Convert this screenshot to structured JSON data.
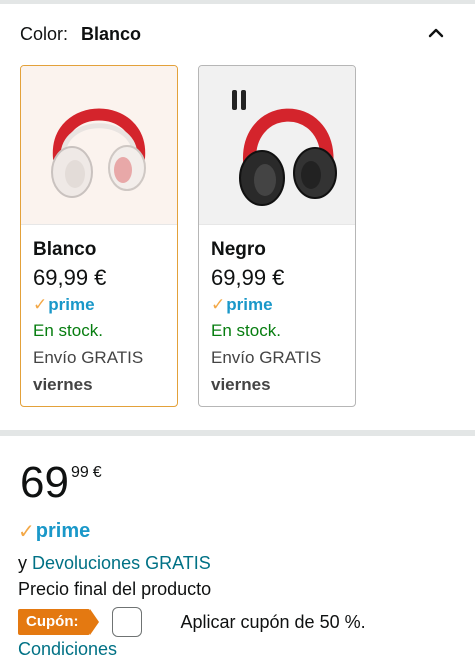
{
  "color_selector": {
    "label": "Color:",
    "selected": "Blanco",
    "swatches": [
      {
        "name": "Blanco",
        "price": "69,99 €",
        "prime": "prime",
        "stock": "En stock.",
        "shipping": "Envío GRATIS",
        "day": "viernes"
      },
      {
        "name": "Negro",
        "price": "69,99 €",
        "prime": "prime",
        "stock": "En stock.",
        "shipping": "Envío GRATIS",
        "day": "viernes"
      }
    ]
  },
  "price": {
    "whole": "69",
    "fraction": "99",
    "currency": "€"
  },
  "prime": {
    "label": "prime"
  },
  "returns": {
    "prefix": "y",
    "link": "Devoluciones GRATIS"
  },
  "final_price_text": "Precio final del producto",
  "coupon": {
    "tag": "Cupón:",
    "text": "Aplicar cupón de 50 %.",
    "conditions": "Condiciones"
  },
  "colors": {
    "prime": "#1a98c9",
    "stock": "#067d0f",
    "coupon": "#e47911",
    "selected_border": "#e3a13a",
    "link": "#007185"
  }
}
